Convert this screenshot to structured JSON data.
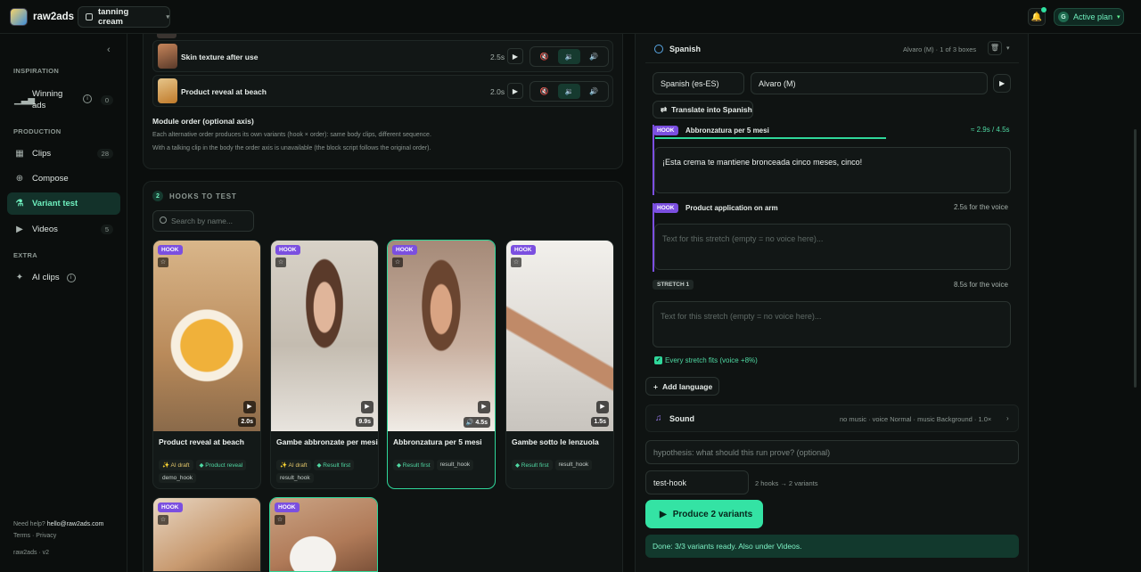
{
  "header": {
    "brand": "raw2ads",
    "project": "tanning cream",
    "plan_initial": "G",
    "plan_label": "Active plan"
  },
  "sidebar": {
    "sections": [
      "INSPIRATION",
      "PRODUCTION",
      "EXTRA"
    ],
    "items": [
      {
        "label": "Winning ads",
        "count": "0",
        "icon": "bar-chart-icon"
      },
      {
        "label": "Clips",
        "count": "28",
        "icon": "film-icon"
      },
      {
        "label": "Compose",
        "icon": "plus-circle-icon"
      },
      {
        "label": "Variant test",
        "icon": "flask-icon",
        "active": true
      },
      {
        "label": "Videos",
        "count": "5",
        "icon": "play-circle-icon"
      },
      {
        "label": "AI clips",
        "icon": "sparkle-icon"
      }
    ],
    "help_prefix": "Need help?",
    "help_email": "hello@raw2ads.com",
    "legal": "Terms · Privacy",
    "version": "raw2ads · v2"
  },
  "modules": {
    "rows": [
      {
        "label": "Skin texture after use",
        "duration": "2.5s",
        "audio_selected": 1
      },
      {
        "label": "Product reveal at beach",
        "duration": "2.0s",
        "audio_selected": 1
      }
    ],
    "order_title": "Module order (optional axis)",
    "order_line1": "Each alternative order produces its own variants (hook × order): same body clips, different sequence.",
    "order_line2": "With a talking clip in the body the order axis is unavailable (the block script follows the original order)."
  },
  "hooks": {
    "step": "2",
    "title": "HOOKS TO TEST",
    "search_placeholder": "Search by name...",
    "tag": "HOOK",
    "star": "☆",
    "cards": [
      {
        "title": "Product reveal at beach",
        "duration": "2.0s",
        "chips": [
          "✨ AI draft",
          "◆ Product reveal",
          "demo_hook"
        ],
        "selected": false
      },
      {
        "title": "Gambe abbronzate per mesi",
        "duration": "9.9s",
        "chips": [
          "✨ AI draft",
          "◆ Result first",
          "result_hook"
        ],
        "selected": false
      },
      {
        "title": "Abbronzatura per 5 mesi",
        "duration": "🔊 4.5s",
        "chips": [
          "◆ Result first",
          "result_hook"
        ],
        "selected": true
      },
      {
        "title": "Gambe sotto le lenzuola",
        "duration": "1.5s",
        "chips": [
          "◆ Result first",
          "result_hook"
        ],
        "selected": false
      }
    ]
  },
  "voice": {
    "language": "Spanish",
    "meta": "Alvaro (M) · 1 of 3 boxes",
    "locale": "Spanish (es-ES)",
    "voice": "Alvaro (M)",
    "translate": "Translate into Spanish",
    "hook_tag": "HOOK",
    "stretch_tag": "STRETCH 1",
    "hook1_name": "Abbronzatura per 5 mesi",
    "hook1_meta": "≈ 2.9s / 4.5s",
    "hook1_progress": 0.64,
    "hook1_text": "¡Esta crema te mantiene bronceada cinco meses, cinco!",
    "hook2_name": "Product application on arm",
    "hook2_meta": "2.5s for the voice",
    "stretch_meta": "8.5s for the voice",
    "placeholder": "Text for this stretch (empty = no voice here)...",
    "fits": "Every stretch fits (voice +8%)",
    "add_language": "Add language",
    "sound_label": "Sound",
    "sound_meta": "no music · voice Normal · music Background · 1.0×",
    "hypothesis_placeholder": "hypothesis: what should this run prove? (optional)",
    "run_name": "test-hook",
    "run_meta": "2 hooks → 2 variants",
    "produce": "Produce 2 variants",
    "done": "Done: 3/3 variants ready. Also under Videos."
  }
}
